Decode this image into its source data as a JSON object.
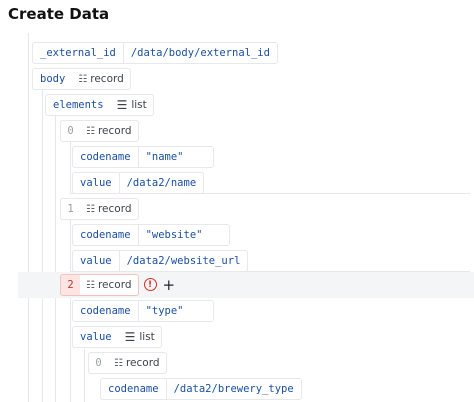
{
  "title": "Create Data",
  "record_label": "record",
  "list_label": "list",
  "rows": {
    "external_id": {
      "key": "_external_id",
      "value": "/data/body/external_id"
    },
    "body": {
      "key": "body"
    },
    "elements": {
      "key": "elements"
    },
    "el0": {
      "index": "0"
    },
    "el0_codename": {
      "key": "codename",
      "value": "\"name\""
    },
    "el0_value": {
      "key": "value",
      "value": "/data2/name"
    },
    "el1": {
      "index": "1"
    },
    "el1_codename": {
      "key": "codename",
      "value": "\"website\""
    },
    "el1_value": {
      "key": "value",
      "value": "/data2/website_url"
    },
    "el2": {
      "index": "2"
    },
    "el2_codename": {
      "key": "codename",
      "value": "\"type\""
    },
    "el2_value": {
      "key": "value"
    },
    "el2_v0": {
      "index": "0"
    },
    "el2_v0_codename": {
      "key": "codename",
      "value": "/data2/brewery_type"
    }
  },
  "icons": {
    "record": "record-icon",
    "list": "list-icon",
    "error": "error-icon",
    "add": "plus-icon"
  },
  "colors": {
    "key_text": "#1a4fa0",
    "error": "#d92d20",
    "error_bg": "#fde5e3",
    "highlight_row": "#f4f5f7"
  }
}
